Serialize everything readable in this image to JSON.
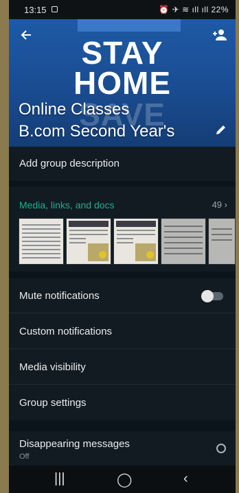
{
  "status_bar": {
    "time": "13:15",
    "battery": "22%"
  },
  "header": {
    "image_text_line1": "STAY",
    "image_text_line2": "HOME",
    "image_text_line3": "SAVE",
    "group_name_line1": "Online Classes",
    "group_name_line2": "B.com Second Year's"
  },
  "description": {
    "label": "Add group description"
  },
  "media": {
    "title": "Media, links, and docs",
    "count": "49"
  },
  "menu": {
    "mute": "Mute notifications",
    "custom": "Custom notifications",
    "visibility": "Media visibility",
    "group_settings": "Group settings",
    "disappearing": "Disappearing messages",
    "disappearing_value": "Off"
  },
  "colors": {
    "accent": "#1fae8f",
    "background": "#121b22",
    "header_blue": "#1d5aa5"
  }
}
